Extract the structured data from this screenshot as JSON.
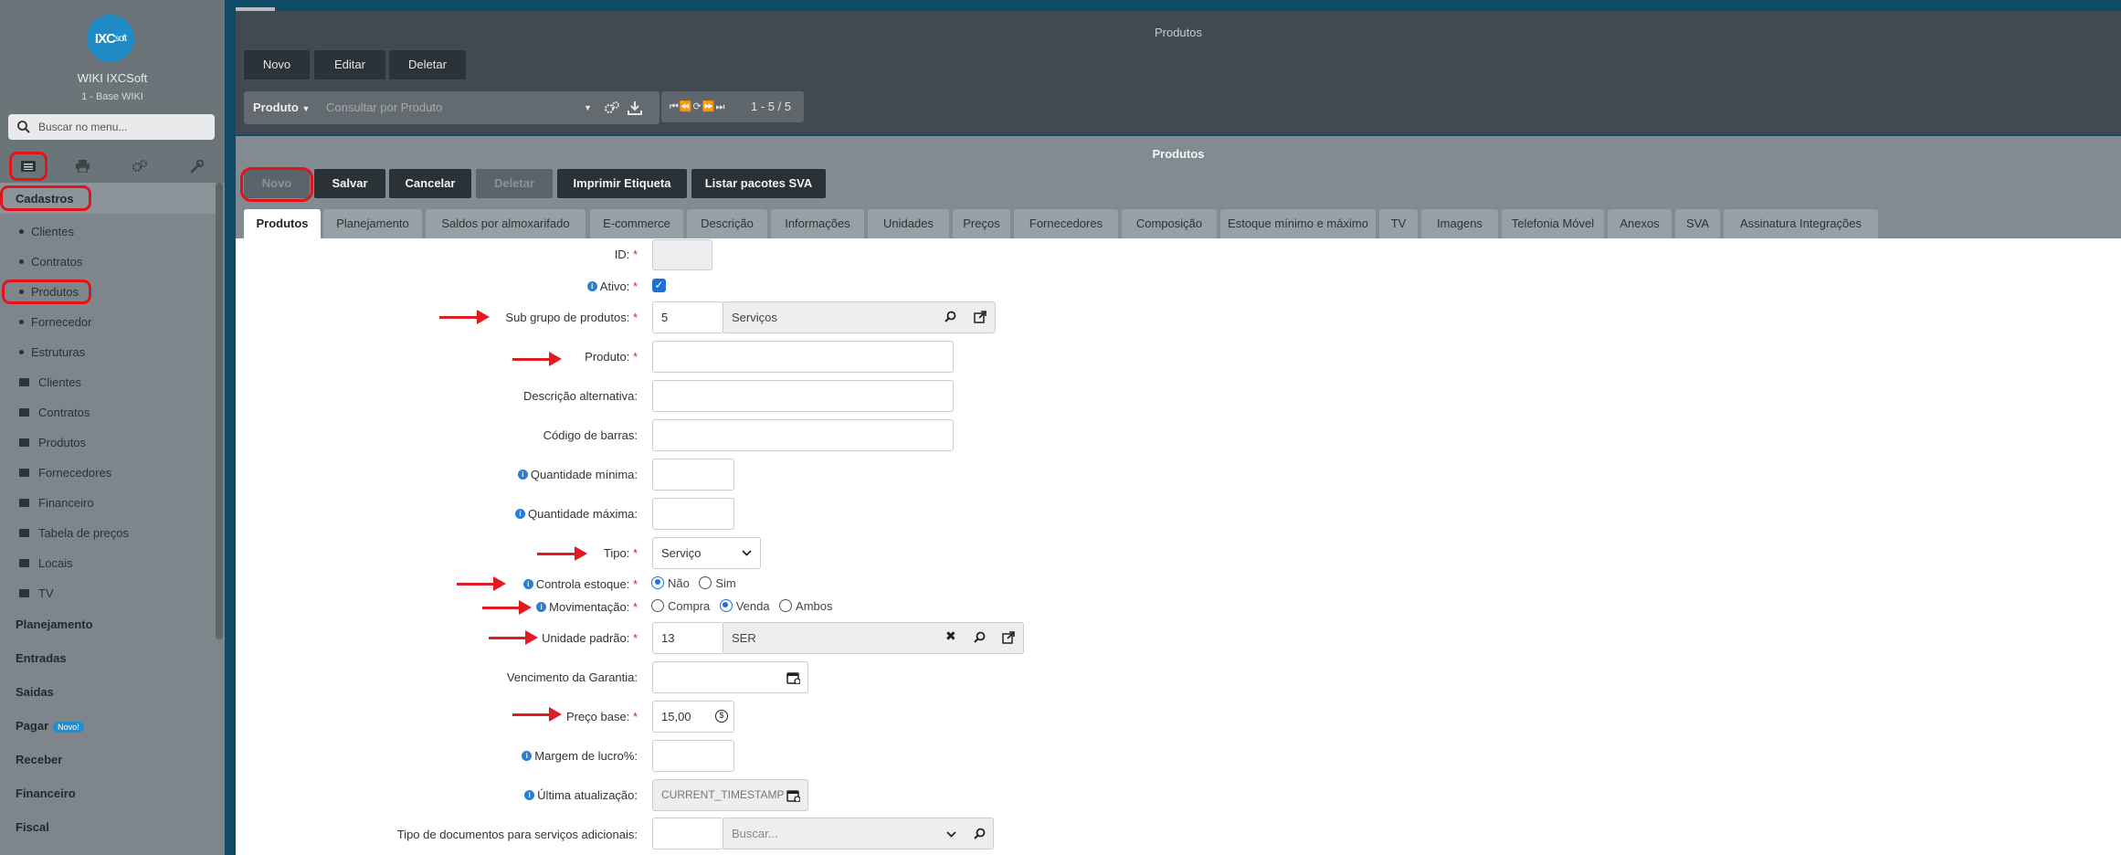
{
  "brand": {
    "logo": "IXCsoft",
    "logo_main": "IXC",
    "logo_suffix": "soft",
    "title": "WIKI IXCSoft",
    "subtitle": "1 - Base WIKI"
  },
  "sidebar": {
    "search_placeholder": "Buscar no menu...",
    "section_active": "Cadastros",
    "items": [
      "Clientes",
      "Contratos",
      "Produtos",
      "Fornecedor",
      "Estruturas"
    ],
    "folders": [
      "Clientes",
      "Contratos",
      "Produtos",
      "Fornecedores",
      "Financeiro",
      "Tabela de preços",
      "Locais",
      "TV"
    ],
    "sections": [
      "Planejamento",
      "Entradas",
      "Saidas",
      "Pagar",
      "Receber",
      "Financeiro",
      "Fiscal"
    ],
    "pagar_badge": "Novo!"
  },
  "list_panel": {
    "title": "Produtos",
    "buttons": {
      "new": "Novo",
      "edit": "Editar",
      "delete": "Deletar"
    },
    "filter_field": "Produto",
    "search_placeholder": "Consultar por Produto",
    "pager": "1 - 5 / 5"
  },
  "form_panel": {
    "title": "Produtos",
    "buttons": {
      "new": "Novo",
      "save": "Salvar",
      "cancel": "Cancelar",
      "delete": "Deletar",
      "print_label": "Imprimir Etiqueta",
      "list_sva": "Listar pacotes SVA"
    },
    "tabs": [
      "Produtos",
      "Planejamento",
      "Saldos por almoxarifado",
      "E-commerce",
      "Descrição",
      "Informações",
      "Unidades",
      "Preços",
      "Fornecedores",
      "Composição",
      "Estoque mínimo e máximo",
      "TV",
      "Imagens",
      "Telefonia Móvel",
      "Anexos",
      "SVA",
      "Assinatura Integrações"
    ]
  },
  "form": {
    "id_label": "ID:",
    "ativo_label": "Ativo:",
    "subgrupo_label": "Sub grupo de produtos:",
    "subgrupo_id": "5",
    "subgrupo_name": "Serviços",
    "produto_label": "Produto:",
    "descricao_label": "Descrição alternativa:",
    "codigo_label": "Código de barras:",
    "qtd_min_label": "Quantidade mínima:",
    "qtd_max_label": "Quantidade máxima:",
    "tipo_label": "Tipo:",
    "tipo_value": "Serviço",
    "controla_label": "Controla estoque:",
    "controla_opts": [
      "Não",
      "Sim"
    ],
    "mov_label": "Movimentação:",
    "mov_opts": [
      "Compra",
      "Venda",
      "Ambos"
    ],
    "unidade_label": "Unidade padrão:",
    "unidade_id": "13",
    "unidade_name": "SER",
    "garantia_label": "Vencimento da Garantia:",
    "preco_label": "Preço base:",
    "preco_value": "15,00",
    "margem_label": "Margem de lucro%:",
    "ultima_label": "Última atualização:",
    "ultima_value": "CURRENT_TIMESTAMP",
    "tipo_doc_label": "Tipo de documentos para serviços adicionais:",
    "tipo_doc_placeholder": "Buscar...",
    "required_mark": "*",
    "info_glyph": "i"
  },
  "colors": {
    "accent": "#1f8cc6",
    "annotation_red": "#e2141b"
  }
}
